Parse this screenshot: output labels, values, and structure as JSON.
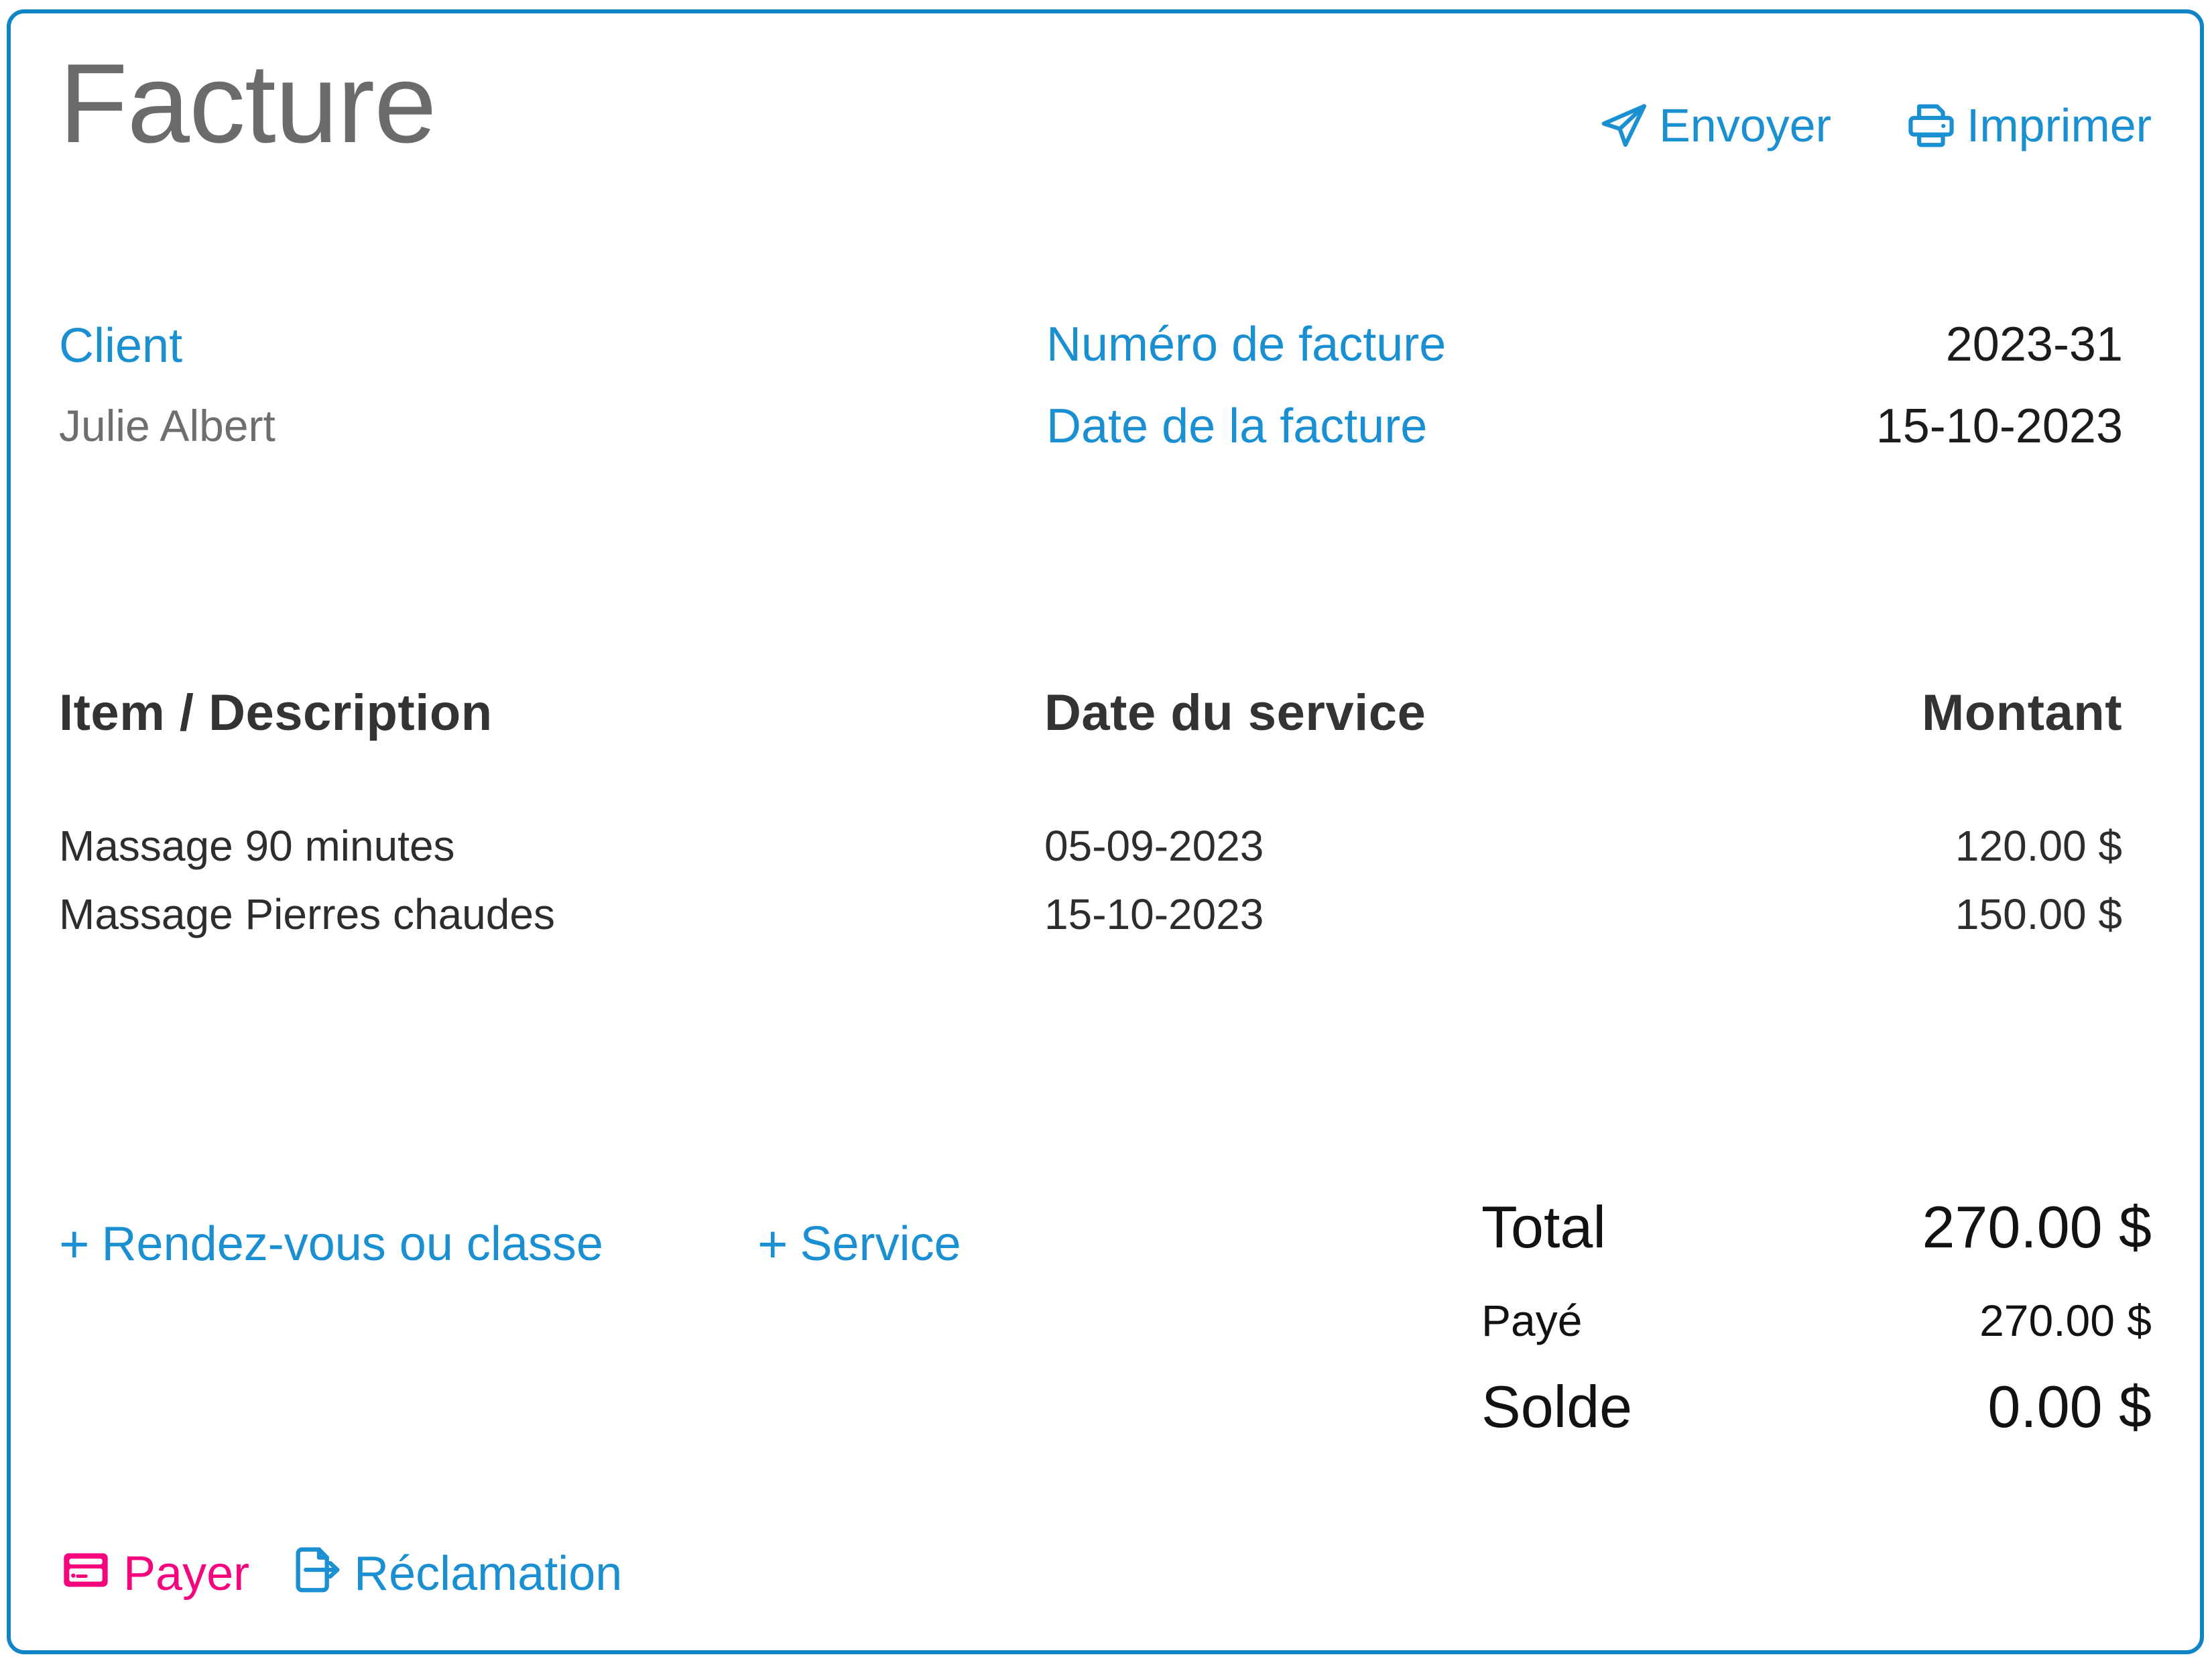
{
  "header": {
    "title": "Facture",
    "actions": [
      {
        "label": "Envoyer",
        "icon": "send-icon"
      },
      {
        "label": "Imprimer",
        "icon": "printer-icon"
      }
    ]
  },
  "client": {
    "label": "Client",
    "name": "Julie Albert"
  },
  "meta": [
    {
      "label": "Numéro de facture",
      "value": "2023-31"
    },
    {
      "label": "Date de la facture",
      "value": "15-10-2023"
    }
  ],
  "items_table": {
    "columns": [
      "Item / Description",
      "Date du service",
      "Montant"
    ],
    "rows": [
      {
        "description": "Massage 90 minutes",
        "date": "05-09-2023",
        "amount": "120.00 $"
      },
      {
        "description": "Massage Pierres chaudes",
        "date": "15-10-2023",
        "amount": "150.00 $"
      }
    ]
  },
  "add_links": [
    {
      "plus": "+",
      "label": "Rendez-vous ou classe"
    },
    {
      "plus": "+",
      "label": "Service"
    }
  ],
  "totals": [
    {
      "label": "Total",
      "value": "270.00 $"
    },
    {
      "label": "Payé",
      "value": "270.00 $"
    },
    {
      "label": "Solde",
      "value": "0.00 $"
    }
  ],
  "footer_actions": [
    {
      "label": "Payer",
      "icon": "credit-card-icon"
    },
    {
      "label": "Réclamation",
      "icon": "document-export-icon"
    }
  ],
  "colors": {
    "accent_blue": "#1a8fd1",
    "border_blue": "#1184c8",
    "pink": "#f5047d",
    "title_gray": "#6b6b6b",
    "text_dark": "#1c1c1c",
    "text_gray": "#6e6e6e"
  }
}
